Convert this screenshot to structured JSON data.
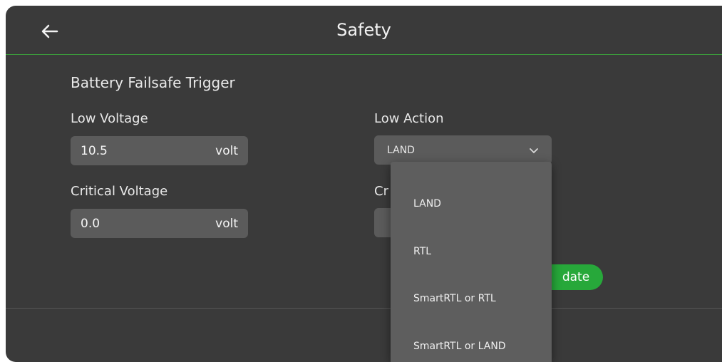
{
  "header": {
    "title": "Safety"
  },
  "battery": {
    "section_title": "Battery Failsafe Trigger",
    "low_voltage": {
      "label": "Low Voltage",
      "value": "10.5",
      "unit": "volt"
    },
    "critical_voltage": {
      "label": "Critical Voltage",
      "value": "0.0",
      "unit": "volt"
    },
    "low_action": {
      "label": "Low Action",
      "selected": "LAND"
    },
    "critical_action": {
      "label_visible": "Cr"
    }
  },
  "update_button_visible": "date",
  "dropdown": {
    "options": [
      "LAND",
      "RTL",
      "SmartRTL or RTL",
      "SmartRTL or LAND"
    ]
  },
  "colors": {
    "accent": "#27a83a",
    "panel": "#3a3a3a",
    "field": "#5b5b5b"
  },
  "icons": {
    "back": "arrow-left-icon",
    "chevron": "chevron-down-icon"
  }
}
